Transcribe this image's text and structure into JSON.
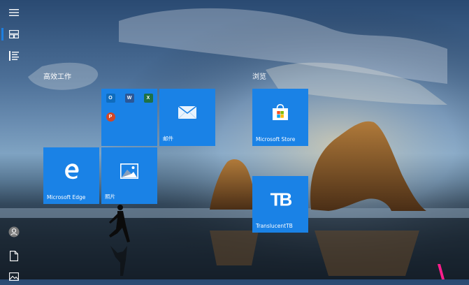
{
  "sidebar": {
    "items": [
      {
        "name": "menu-button",
        "icon": "hamburger-icon"
      },
      {
        "name": "pinned-tiles-button",
        "icon": "tiles-icon"
      },
      {
        "name": "all-apps-button",
        "icon": "list-icon"
      },
      {
        "name": "user-button",
        "icon": "user-icon"
      },
      {
        "name": "documents-button",
        "icon": "document-icon"
      },
      {
        "name": "pictures-button",
        "icon": "picture-icon"
      }
    ]
  },
  "groups": {
    "productivity": {
      "title": "高效工作"
    },
    "browse": {
      "title": "浏览"
    }
  },
  "tiles": {
    "office": {
      "apps": [
        {
          "icon": "outlook-icon",
          "letter": "O",
          "color": "#0f6cbd"
        },
        {
          "icon": "word-icon",
          "letter": "W",
          "color": "#2b5797"
        },
        {
          "icon": "excel-icon",
          "letter": "X",
          "color": "#1e7145"
        },
        {
          "icon": "powerpoint-icon",
          "letter": "P",
          "color": "#d24726"
        }
      ]
    },
    "mail": {
      "label": "邮件",
      "icon": "mail-icon"
    },
    "edge": {
      "label": "Microsoft Edge",
      "icon": "edge-icon"
    },
    "photos": {
      "label": "照片",
      "icon": "photos-icon"
    },
    "store": {
      "label": "Microsoft Store",
      "icon": "store-icon"
    },
    "translucenttb": {
      "label": "TranslucentTB",
      "icon": "translucenttb-icon",
      "glyph": "TB"
    }
  },
  "colors": {
    "tile": "#1a82e6",
    "accent": "#1e7fe0",
    "pink": "#ff1e8c"
  }
}
